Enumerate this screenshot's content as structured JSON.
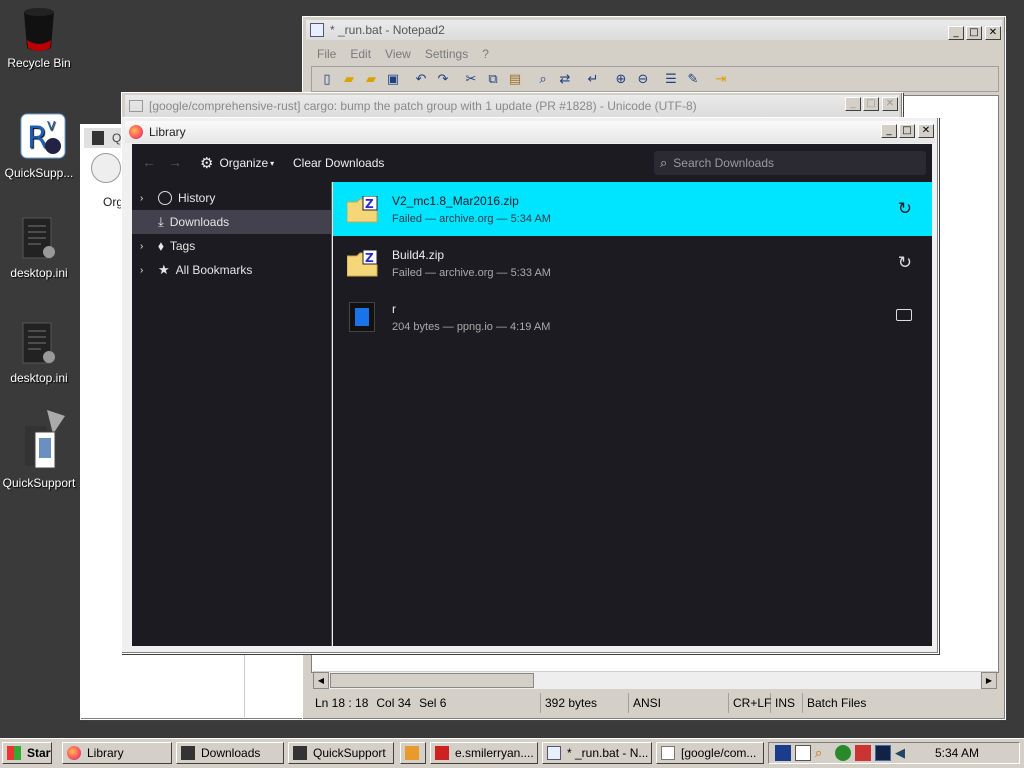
{
  "desktop": {
    "icons": [
      {
        "label": "Recycle Bin"
      },
      {
        "label": "QuickSupp..."
      },
      {
        "label": "desktop.ini"
      },
      {
        "label": "desktop.ini"
      },
      {
        "label": "QuickSupport"
      }
    ]
  },
  "bg_window": {
    "title_fragment": "Qu",
    "org_fragment": "Org"
  },
  "notepad": {
    "title": "* _run.bat - Notepad2",
    "menu": [
      "File",
      "Edit",
      "View",
      "Settings",
      "?"
    ],
    "status": {
      "pos": "Ln 18 : 18",
      "col": "Col 34",
      "sel": "Sel 6",
      "size": "392 bytes",
      "encoding": "ANSI",
      "eol": "CR+LF",
      "ins": "INS",
      "lang": "Batch Files"
    }
  },
  "github_window": {
    "title": "[google/comprehensive-rust] cargo: bump the patch group with 1 update (PR #1828) - Unicode (UTF-8)"
  },
  "library": {
    "title": "Library",
    "toolbar": {
      "organize": "Organize",
      "clear_downloads": "Clear Downloads",
      "search_placeholder": "Search Downloads"
    },
    "sidebar": [
      {
        "label": "History"
      },
      {
        "label": "Downloads"
      },
      {
        "label": "Tags"
      },
      {
        "label": "All Bookmarks"
      }
    ],
    "downloads": [
      {
        "name": "V2_mc1.8_Mar2016.zip",
        "meta": "Failed — archive.org — 5:34 AM",
        "action": "retry-icon"
      },
      {
        "name": "Build4.zip",
        "meta": "Failed — archive.org — 5:33 AM",
        "action": "retry-icon"
      },
      {
        "name": "r",
        "meta": "204 bytes — ppng.io — 4:19 AM",
        "action": "folder-icon"
      }
    ],
    "colors": {
      "selected": "#00e5ff",
      "bg": "#1c1b22",
      "sidebar": "#1c1b22",
      "toolbar": "#2b2a33"
    }
  },
  "taskbar": {
    "start": "Start",
    "buttons": [
      {
        "label": "Library"
      },
      {
        "label": "Downloads"
      },
      {
        "label": "QuickSupport"
      },
      {
        "label": "e.smilerryan...."
      },
      {
        "label": "* _run.bat - N..."
      },
      {
        "label": "[google/com..."
      }
    ],
    "clock": "5:34 AM"
  }
}
